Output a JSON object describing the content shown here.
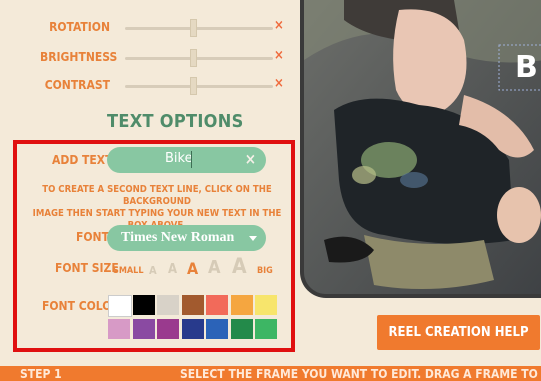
{
  "sliders": [
    {
      "label": "ROTATION",
      "close": "×"
    },
    {
      "label": "BRIGHTNESS",
      "close": "×"
    },
    {
      "label": "CONTRAST",
      "close": "×"
    }
  ],
  "text_options": {
    "heading": "TEXT OPTIONS",
    "add_text_label": "ADD TEXT",
    "add_text_value": "Bike",
    "clear": "×",
    "hint_line1": "TO CREATE A SECOND TEXT LINE, CLICK ON THE BACKGROUND",
    "hint_line2": "IMAGE THEN START TYPING YOUR NEW TEXT IN THE BOX ABOVE.",
    "font_label": "FONT",
    "font_value": "Times New Roman",
    "font_size_label": "FONT SIZE",
    "size_small": "SMALL",
    "size_big": "BIG",
    "size_glyph": "A",
    "font_color_label": "FONT COLOR",
    "colors": [
      "#ffffff",
      "#000000",
      "#d8d2c8",
      "#a25a2e",
      "#f26a5a",
      "#f5a640",
      "#f7e56c",
      "#d79ac6",
      "#8a4aa2",
      "#9a3a8e",
      "#283a8c",
      "#2b63b8",
      "#238a4a",
      "#3db664"
    ]
  },
  "preview": {
    "overlay_text": "B"
  },
  "reel_help_button": "REEL CREATION HELP",
  "step": {
    "label": "STEP 1",
    "instruction": "SELECT THE FRAME YOU WANT TO EDIT. DRAG A FRAME TO REA"
  }
}
